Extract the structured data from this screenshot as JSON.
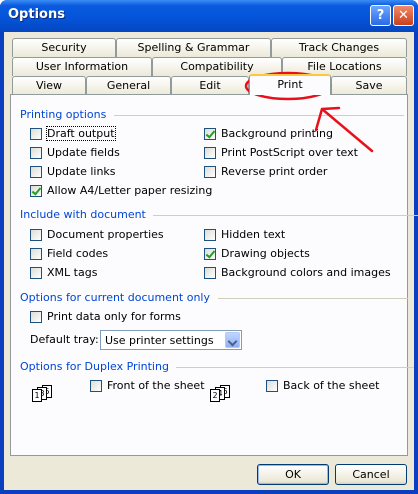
{
  "window": {
    "title": "Options"
  },
  "titlebar": {
    "help_label": "?",
    "close_label": "✕"
  },
  "tabs": {
    "row1": [
      "Security",
      "Spelling & Grammar",
      "Track Changes"
    ],
    "row2": [
      "User Information",
      "Compatibility",
      "File Locations"
    ],
    "row3": [
      "View",
      "General",
      "Edit",
      "Print",
      "Save"
    ],
    "active": "Print"
  },
  "printing_options": {
    "heading": "Printing options",
    "left": [
      {
        "label": "Draft output",
        "checked": false
      },
      {
        "label": "Update fields",
        "checked": false
      },
      {
        "label": "Update links",
        "checked": false
      },
      {
        "label": "Allow A4/Letter paper resizing",
        "checked": true
      }
    ],
    "right": [
      {
        "label": "Background printing",
        "checked": true
      },
      {
        "label": "Print PostScript over text",
        "checked": false
      },
      {
        "label": "Reverse print order",
        "checked": false
      }
    ]
  },
  "include_with_document": {
    "heading": "Include with document",
    "left": [
      {
        "label": "Document properties",
        "checked": false
      },
      {
        "label": "Field codes",
        "checked": false
      },
      {
        "label": "XML tags",
        "checked": false
      }
    ],
    "right": [
      {
        "label": "Hidden text",
        "checked": false
      },
      {
        "label": "Drawing objects",
        "checked": true
      },
      {
        "label": "Background colors and images",
        "checked": false
      }
    ]
  },
  "current_document": {
    "heading": "Options for current document only",
    "print_data_only": {
      "label": "Print data only for forms",
      "checked": false
    },
    "default_tray_label": "Default tray:",
    "default_tray_value": "Use printer settings"
  },
  "duplex": {
    "heading": "Options for Duplex Printing",
    "front": {
      "label": "Front of the sheet",
      "checked": false,
      "icon_pages": [
        "1",
        "3",
        "5"
      ]
    },
    "back": {
      "label": "Back of the sheet",
      "checked": false,
      "icon_pages": [
        "2",
        "4",
        "6"
      ]
    }
  },
  "buttons": {
    "ok": "OK",
    "cancel": "Cancel"
  },
  "colors": {
    "annotation": "#e8101a",
    "title_bar": "#0453d8",
    "section_heading": "#0046d5"
  }
}
